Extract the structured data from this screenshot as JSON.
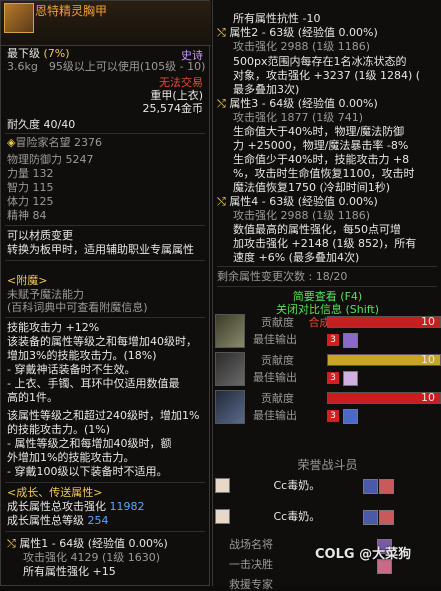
{
  "item": {
    "name": "恩特精灵胸甲",
    "grade": "最下级",
    "grade_pct": "(7%)",
    "rarity": "史诗",
    "weight_level": "3.6kg　95级以上可以使用(105级 - 10)",
    "trade": "无法交易",
    "armor_type": "重甲(上衣)",
    "price": "25,574金币",
    "durability": "耐久度 40/40",
    "fame_label": "冒险家名望",
    "fame_value": "2376",
    "stats": [
      {
        "label": "物理防御力",
        "value": "5247"
      },
      {
        "label": "力量",
        "value": "132"
      },
      {
        "label": "智力",
        "value": "115"
      },
      {
        "label": "体力",
        "value": "125"
      },
      {
        "label": "精神",
        "value": "84"
      }
    ],
    "material_change": "可以材质变更",
    "material_desc": "转换为板甲时，适用辅助职业专属属性",
    "enchant_header": "<附魔>",
    "enchant_none": "未赋予魔法能力",
    "enchant_hint": "(百科词典中可查看附魔信息)",
    "skill_line": "技能攻击力 +12%",
    "effect_lines": [
      "该装备的属性等级之和每增加40级时，",
      "增加3%的技能攻击力。(18%)",
      "- 穿戴神话装备时不生效。",
      "- 上衣、手镯、耳环中仅适用数值最",
      "高的1件。",
      "该属性等级之和超过240级时，增加1%",
      "的技能攻击力。(1%)",
      "- 属性等级之和每增加40级时，额",
      "外增加1%的技能攻击力。",
      "- 穿戴100级以下装备时不适用。"
    ],
    "growth_header": "<成长、传送属性>",
    "growth_total_label": "成长属性总攻击强化",
    "growth_total_value": "11982",
    "growth_level_label": "成长属性总等级",
    "growth_level_value": "254",
    "attr1_line": "属性1 - 64级 (经验值 0.00%)",
    "attr1_atk": "攻击强化 4129 (1级 1630)",
    "attr1_all": "所有属性强化 +15"
  },
  "right": {
    "resist": "所有属性抗性 -10",
    "attr2_line": "属性2 - 63级 (经验值 0.00%)",
    "attr2_atk": "攻击强化 2988 (1级 1186)",
    "attr2_desc": [
      "500px范围内每存在1名冰冻状态的",
      "对象，攻击强化 +3237 (1级 1284) (",
      "最多叠加3次)"
    ],
    "attr3_line": "属性3 - 64级 (经验值 0.00%)",
    "attr3_atk": "攻击强化 1877 (1级 741)",
    "attr3_desc": [
      "生命值大于40%时，物理/魔法防御",
      "力 +25000，物理/魔法暴击率 -8%",
      "生命值少于40%时，技能攻击力 +8",
      "%，攻击时生命值恢复1100，攻击时",
      "魔法值恢复1750 (冷却时间1秒)"
    ],
    "attr4_line": "属性4 - 63级 (经验值 0.00%)",
    "attr4_atk": "攻击强化 2988 (1级 1186)",
    "attr4_desc": [
      "数值最高的属性强化，每50点可增",
      "加攻击强化 +2148 (1级 852)，所有",
      "速度 +6% (最多叠加4次)"
    ],
    "remain_label": "剩余属性变更次数 : 18/20",
    "btn_view": "简要查看 (F4)",
    "btn_close": "关闭对比信息 (Shift)",
    "btn_synth": "合成[X]",
    "contrib_label": "贡献度",
    "best_label": "最佳输出",
    "level_badge": "3",
    "bar_value_label": "10",
    "contrib_rows": [
      {
        "fill_pct": 100,
        "color": "#c81e1e"
      },
      {
        "fill_pct": 100,
        "color": "#c9a526"
      },
      {
        "fill_pct": 100,
        "color": "#c81e1e"
      }
    ],
    "team_title": "荣誉战斗员",
    "members": [
      "Cc毒奶。",
      "Cc毒奶。"
    ],
    "footer": [
      "战场名将",
      "一击决胜",
      "救援专家"
    ]
  },
  "watermark": "COLG @大菜狗"
}
